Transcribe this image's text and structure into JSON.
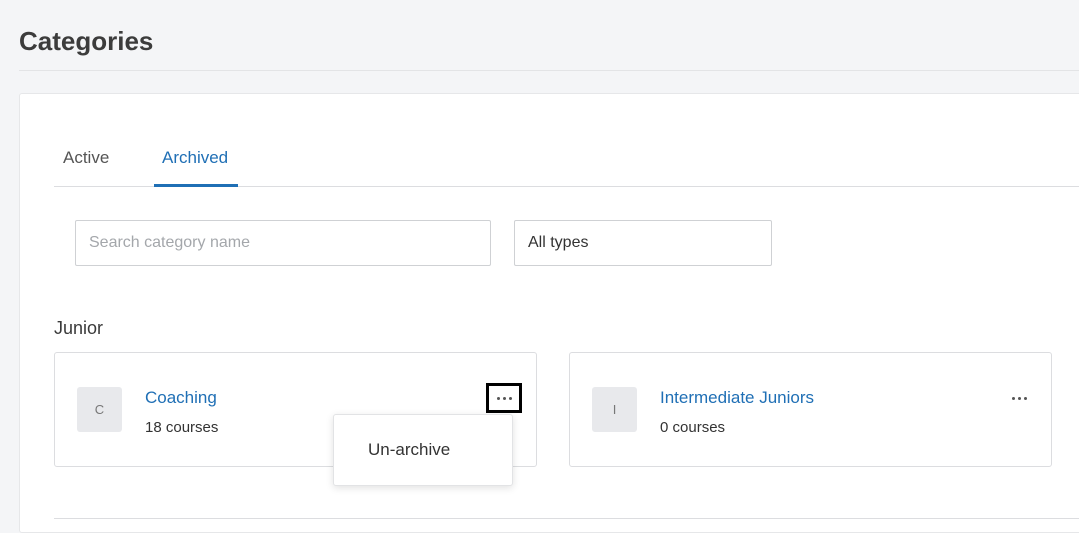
{
  "page": {
    "title": "Categories"
  },
  "tabs": [
    {
      "label": "Active"
    },
    {
      "label": "Archived"
    }
  ],
  "active_tab": "Archived",
  "filters": {
    "search_placeholder": "Search category name",
    "search_value": "",
    "type_selected": "All types"
  },
  "groups": [
    {
      "label": "Junior",
      "cards": [
        {
          "initial": "C",
          "name": "Coaching",
          "count": "18 courses"
        },
        {
          "initial": "I",
          "name": "Intermediate Juniors",
          "count": "0 courses"
        }
      ]
    }
  ],
  "context_menu": {
    "item_label": "Un-archive"
  },
  "colors": {
    "accent": "#1f6fb5",
    "background": "#f4f5f7",
    "panel": "#ffffff"
  },
  "icons": {
    "more": "more-horizontal-icon"
  }
}
